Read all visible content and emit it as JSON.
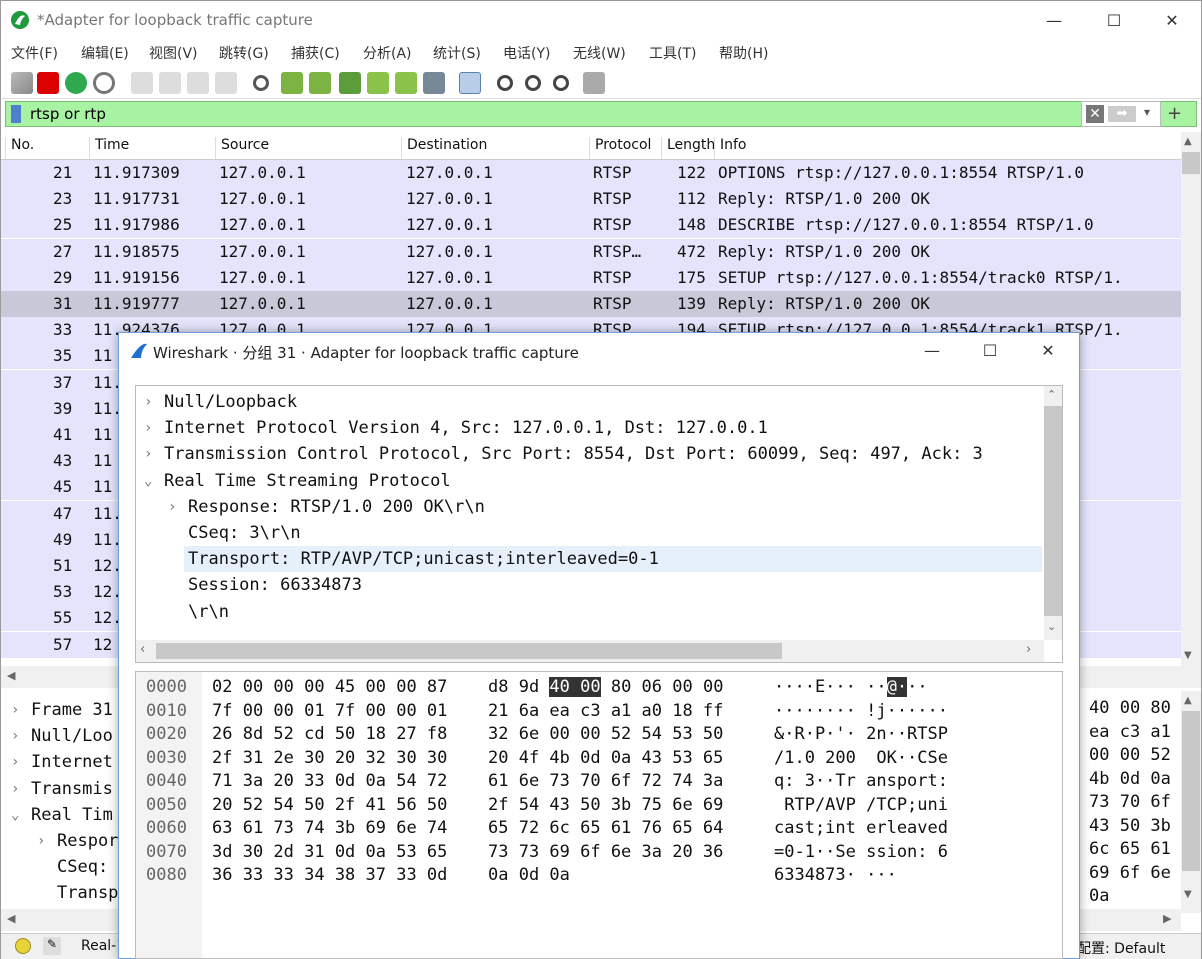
{
  "window": {
    "title": "*Adapter for loopback traffic capture",
    "min_icon": "minimize-icon",
    "max_icon": "maximize-icon",
    "close_icon": "close-icon"
  },
  "menu": [
    "文件(F)",
    "编辑(E)",
    "视图(V)",
    "跳转(G)",
    "捕获(C)",
    "分析(A)",
    "统计(S)",
    "电话(Y)",
    "无线(W)",
    "工具(T)",
    "帮助(H)"
  ],
  "filter": {
    "value": "rtsp or rtp",
    "plus": "+"
  },
  "columns": [
    "No.",
    "Time",
    "Source",
    "Destination",
    "Protocol",
    "Length",
    "Info"
  ],
  "packets": [
    {
      "no": "21",
      "time": "11.917309",
      "src": "127.0.0.1",
      "dst": "127.0.0.1",
      "proto": "RTSP",
      "len": "122",
      "info": "OPTIONS rtsp://127.0.0.1:8554 RTSP/1.0"
    },
    {
      "no": "23",
      "time": "11.917731",
      "src": "127.0.0.1",
      "dst": "127.0.0.1",
      "proto": "RTSP",
      "len": "112",
      "info": "Reply: RTSP/1.0 200 OK"
    },
    {
      "no": "25",
      "time": "11.917986",
      "src": "127.0.0.1",
      "dst": "127.0.0.1",
      "proto": "RTSP",
      "len": "148",
      "info": "DESCRIBE rtsp://127.0.0.1:8554 RTSP/1.0"
    },
    {
      "no": "27",
      "time": "11.918575",
      "src": "127.0.0.1",
      "dst": "127.0.0.1",
      "proto": "RTSP…",
      "len": "472",
      "info": "Reply: RTSP/1.0 200 OK"
    },
    {
      "no": "29",
      "time": "11.919156",
      "src": "127.0.0.1",
      "dst": "127.0.0.1",
      "proto": "RTSP",
      "len": "175",
      "info": "SETUP rtsp://127.0.0.1:8554/track0 RTSP/1."
    },
    {
      "no": "31",
      "time": "11.919777",
      "src": "127.0.0.1",
      "dst": "127.0.0.1",
      "proto": "RTSP",
      "len": "139",
      "info": "Reply: RTSP/1.0 200 OK"
    },
    {
      "no": "33",
      "time": "11.924376",
      "src": "127.0.0.1",
      "dst": "127.0.0.1",
      "proto": "RTSP",
      "len": "194",
      "info": "SETUP rtsp://127.0.0.1:8554/track1 RTSP/1."
    },
    {
      "no": "35",
      "time": "11",
      "src": "",
      "dst": "",
      "proto": "",
      "len": "",
      "info": ""
    },
    {
      "no": "37",
      "time": "11.",
      "src": "",
      "dst": "",
      "proto": "",
      "len": "",
      "info": ".0"
    },
    {
      "no": "39",
      "time": "11.",
      "src": "",
      "dst": "",
      "proto": "",
      "len": "",
      "info": ""
    },
    {
      "no": "41",
      "time": "11",
      "src": "",
      "dst": "",
      "proto": "",
      "len": "",
      "info": "11, Seq=0"
    },
    {
      "no": "43",
      "time": "11",
      "src": "",
      "dst": "",
      "proto": "",
      "len": "",
      "info": "23423, Se"
    },
    {
      "no": "45",
      "time": "11",
      "src": "",
      "dst": "",
      "proto": "",
      "len": "",
      "info": "23423, Se"
    },
    {
      "no": "47",
      "time": "11.",
      "src": "",
      "dst": "",
      "proto": "",
      "len": "",
      "info": "11, Seq=1"
    },
    {
      "no": "49",
      "time": "11.",
      "src": "",
      "dst": "",
      "proto": "",
      "len": "",
      "info": "23423, Se"
    },
    {
      "no": "51",
      "time": "12.",
      "src": "",
      "dst": "",
      "proto": "",
      "len": "",
      "info": "11, Seq=2"
    },
    {
      "no": "53",
      "time": "12.",
      "src": "",
      "dst": "",
      "proto": "",
      "len": "",
      "info": "23423, Se"
    },
    {
      "no": "55",
      "time": "12.",
      "src": "",
      "dst": "",
      "proto": "",
      "len": "",
      "info": "11, Seq=3"
    },
    {
      "no": "57",
      "time": "12",
      "src": "",
      "dst": "",
      "proto": "",
      "len": "",
      "info": "23423, Se"
    }
  ],
  "details_bg": [
    "Frame 31",
    "Null/Loo",
    "Internet",
    "Transmis",
    "Real Tim",
    "Respor",
    "CSeq:",
    "Transp"
  ],
  "hex_bg_right": [
    "40 00 80",
    "ea c3 a1",
    "00 00 52",
    "4b 0d 0a",
    "73 70 6f",
    "43 50 3b",
    "6c 65 61",
    "69 6f 6e",
    "0a"
  ],
  "status": {
    "left": "Real-1",
    "right": "配置: Default"
  },
  "popup": {
    "title": "Wireshark · 分组 31 · Adapter for loopback traffic capture",
    "tree": [
      {
        "text": "Null/Loopback",
        "indent": 0,
        "arrow": "›"
      },
      {
        "text": "Internet Protocol Version 4, Src: 127.0.0.1, Dst: 127.0.0.1",
        "indent": 0,
        "arrow": "›"
      },
      {
        "text": "Transmission Control Protocol, Src Port: 8554, Dst Port: 60099, Seq: 497, Ack: 3",
        "indent": 0,
        "arrow": "›"
      },
      {
        "text": "Real Time Streaming Protocol",
        "indent": 0,
        "arrow": "⌄"
      },
      {
        "text": "Response: RTSP/1.0 200 OK\\r\\n",
        "indent": 1,
        "arrow": "›"
      },
      {
        "text": "CSeq: 3\\r\\n",
        "indent": 1,
        "arrow": ""
      },
      {
        "text": "Transport: RTP/AVP/TCP;unicast;interleaved=0-1",
        "indent": 1,
        "arrow": "",
        "hl": true
      },
      {
        "text": "Session: 66334873",
        "indent": 1,
        "arrow": ""
      },
      {
        "text": "\\r\\n",
        "indent": 1,
        "arrow": ""
      }
    ],
    "hex": [
      {
        "off": "0000",
        "a": "02 00 00 00 45 00 00 87",
        "b1": "d8 9d ",
        "sel": "40 00",
        "b2": " 80 06 00 00",
        "ascii": "····E··· ··",
        "asel": "@·",
        "aend": "··"
      },
      {
        "off": "0010",
        "a": "7f 00 00 01 7f 00 00 01",
        "b1": "21 6a ea c3 a1 a0 18 ff",
        "sel": "",
        "b2": "",
        "ascii": "········ !j······",
        "asel": "",
        "aend": ""
      },
      {
        "off": "0020",
        "a": "26 8d 52 cd 50 18 27 f8",
        "b1": "32 6e 00 00 52 54 53 50",
        "sel": "",
        "b2": "",
        "ascii": "&·R·P·'· 2n··RTSP",
        "asel": "",
        "aend": ""
      },
      {
        "off": "0030",
        "a": "2f 31 2e 30 20 32 30 30",
        "b1": "20 4f 4b 0d 0a 43 53 65",
        "sel": "",
        "b2": "",
        "ascii": "/1.0 200  OK··CSe",
        "asel": "",
        "aend": ""
      },
      {
        "off": "0040",
        "a": "71 3a 20 33 0d 0a 54 72",
        "b1": "61 6e 73 70 6f 72 74 3a",
        "sel": "",
        "b2": "",
        "ascii": "q: 3··Tr ansport:",
        "asel": "",
        "aend": ""
      },
      {
        "off": "0050",
        "a": "20 52 54 50 2f 41 56 50",
        "b1": "2f 54 43 50 3b 75 6e 69",
        "sel": "",
        "b2": "",
        "ascii": " RTP/AVP /TCP;uni",
        "asel": "",
        "aend": ""
      },
      {
        "off": "0060",
        "a": "63 61 73 74 3b 69 6e 74",
        "b1": "65 72 6c 65 61 76 65 64",
        "sel": "",
        "b2": "",
        "ascii": "cast;int erleaved",
        "asel": "",
        "aend": ""
      },
      {
        "off": "0070",
        "a": "3d 30 2d 31 0d 0a 53 65",
        "b1": "73 73 69 6f 6e 3a 20 36",
        "sel": "",
        "b2": "",
        "ascii": "=0-1··Se ssion: 6",
        "asel": "",
        "aend": ""
      },
      {
        "off": "0080",
        "a": "36 33 33 34 38 37 33 0d",
        "b1": "0a 0d 0a",
        "sel": "",
        "b2": "",
        "ascii": "6334873· ···",
        "asel": "",
        "aend": ""
      }
    ]
  }
}
